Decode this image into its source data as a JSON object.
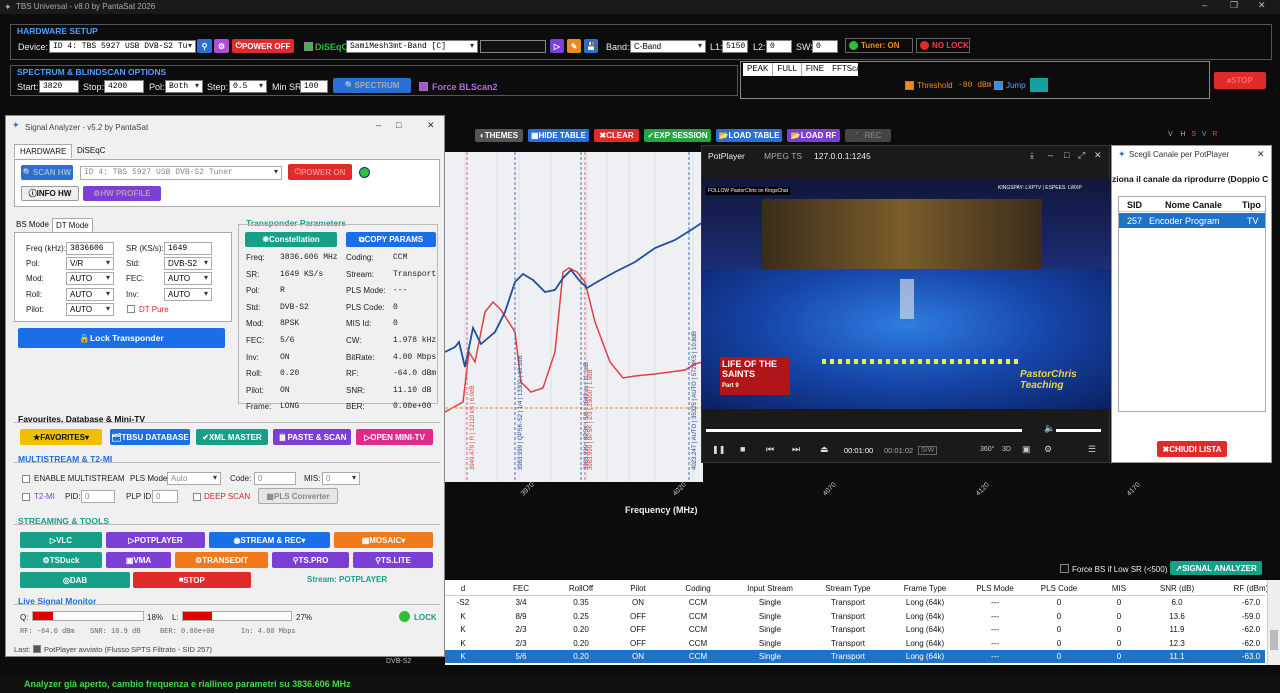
{
  "app": {
    "title": "TBS Universal - v8.0 by PantaSat 2026"
  },
  "hw": {
    "section": "HARDWARE SETUP",
    "device_label": "Device:",
    "device": "ID 4: TBS 5927 USB DVB-S2 Tu",
    "power": "POWER OFF",
    "diseqc": "DiSEqC",
    "sat": "SamiMesh3mt-Band [C]",
    "band_label": "Band:",
    "band": "C-Band",
    "l1_label": "L1:",
    "l1": "5150",
    "l2_label": "L2:",
    "l2": "0",
    "sw_label": "SW:",
    "sw": "0",
    "tuner": "Tuner: ON",
    "lock": "NO LOCK"
  },
  "spec": {
    "section": "SPECTRUM & BLINDSCAN OPTIONS",
    "start_label": "Start:",
    "start": "3820",
    "stop_label": "Stop:",
    "stop": "4200",
    "pol_label": "Pol:",
    "pol": "Both",
    "step_label": "Step:",
    "step": "0.5",
    "minsr_label": "Min SR:",
    "minsr": "100",
    "scan": "SPECTRUM",
    "force": "Force BLScan2",
    "tabs": [
      "PEAK",
      "FULL",
      "FINE",
      "FFTScan"
    ],
    "threshold": "Threshold",
    "threshold_val": "-80 dBm",
    "jump": "Jump",
    "stop_btn": "STOP"
  },
  "toolbar": {
    "themes": "THEMES",
    "hide": "HIDE TABLE",
    "clear": "CLEAR",
    "exp": "EXP SESSION",
    "load_table": "LOAD TABLE",
    "load_rf": "LOAD RF",
    "rec": "REC"
  },
  "chart_data": {
    "type": "line",
    "xlabel": "Frequency (MHz)",
    "x_ticks": [
      "3970",
      "4020",
      "4070",
      "4120",
      "4170"
    ],
    "series": [
      {
        "name": "blue",
        "color": "#1e4fa0"
      },
      {
        "name": "red",
        "color": "#e04040"
      }
    ],
    "legend_vals": [
      "V",
      "H",
      "S",
      "V",
      "R"
    ],
    "markers": [
      "3949.479 | R | 12110 kS | 6.0dB",
      "3983.999 | QPSK-S2 | 1/4 | 13300 | 10.1dB",
      "3983.999 | 8PSK | 5/6 | 1649 ks | 11.1dB",
      "3983.999 | 8PSK | 2/3 | 23000 | 1.9dB",
      "4023.247 | AUTO | 35325 | AUTO | 5728KS | 10.8dB"
    ]
  },
  "analyzer": {
    "title": "Signal Analyzer - v5.2 by PantaSat",
    "tabs": [
      "HARDWARE",
      "DiSEqC"
    ],
    "scan_hw": "SCAN HW",
    "device": "ID 4: TBS 5927 USB DVB-S2 Tuner",
    "power": "POWER ON",
    "info_hw": "INFO HW",
    "hw_profile": "HW PROFILE",
    "mode_tabs": [
      "BS Mode",
      "DT Mode"
    ],
    "freq_label": "Freq (kHz):",
    "freq": "3836606",
    "sr_label": "SR (KS/s):",
    "sr": "1649",
    "pol_label": "Pol:",
    "pol": "V/R",
    "std_label": "Std:",
    "std": "DVB-S2",
    "mod_label": "Mod:",
    "mod": "AUTO",
    "fec_label": "FEC:",
    "fec": "AUTO",
    "roll_label": "Roll:",
    "roll": "AUTO",
    "inv_label": "Inv:",
    "inv": "AUTO",
    "pilot_label": "Pilot:",
    "pilot": "AUTO",
    "dtpure": "DT Pure",
    "lock_btn": "Lock Transponder",
    "tp_title": "Transponder Parameters",
    "constellation": "Constellation",
    "copy": "COPY PARAMS",
    "params_left": [
      [
        "Freq:",
        "3836.606 MHz"
      ],
      [
        "SR:",
        "1649 KS/s"
      ],
      [
        "Pol:",
        "R"
      ],
      [
        "Std:",
        "DVB-S2"
      ],
      [
        "Mod:",
        "8PSK"
      ],
      [
        "FEC:",
        "5/6"
      ],
      [
        "Inv:",
        "ON"
      ],
      [
        "Roll:",
        "0.20"
      ],
      [
        "Pilot:",
        "ON"
      ],
      [
        "Frame:",
        "LONG"
      ]
    ],
    "params_right": [
      [
        "Coding:",
        "CCM"
      ],
      [
        "Stream:",
        "Transport"
      ],
      [
        "PLS Mode:",
        "---"
      ],
      [
        "PLS Code:",
        "0"
      ],
      [
        "MIS Id:",
        "0"
      ],
      [
        "CW:",
        "1.978 kHz"
      ],
      [
        "BitRate:",
        "4.00 Mbps"
      ],
      [
        "RF:",
        "-64.0 dBm"
      ],
      [
        "SNR:",
        "11.10 dB"
      ],
      [
        "BER:",
        "0.00e+00"
      ]
    ],
    "fav_title": "Favourites, Database & Mini-TV",
    "fav": "FAVORITES",
    "tbsu": "TBSU DATABASE",
    "xml": "XML MASTER",
    "paste": "PASTE & SCAN",
    "minitv": "OPEN MINI-TV",
    "ms_title": "MULTISTREAM & T2-MI",
    "enable_ms": "ENABLE MULTISTREAM",
    "pls_mode_label": "PLS Mode:",
    "pls_mode": "Auto",
    "code_label": "Code:",
    "code": "0",
    "mis_label": "MIS:",
    "mis": "0",
    "t2mi": "T2-MI",
    "pid_label": "PID:",
    "pid": "0",
    "plp_label": "PLP ID:",
    "plp": "0",
    "deepscan": "DEEP SCAN",
    "pls_conv": "PLS Converter",
    "st_title": "STREAMING & TOOLS",
    "vlc": "VLC",
    "potplayer": "POTPLAYER",
    "stream_rec": "STREAM & REC",
    "mosaic": "MOSAIC",
    "tsduck": "TSDuck",
    "vma": "VMA",
    "transedit": "TRANSEDIT",
    "tspro": "TS.PRO",
    "tslite": "TS.LITE",
    "dab": "DAB",
    "stop": "STOP",
    "stream_status": "Stream: POTPLAYER",
    "mon_title": "Live Signal Monitor",
    "q_label": "Q:",
    "q_pct": "18%",
    "q_level": 0.18,
    "l_label": "L:",
    "l_pct": "27%",
    "l_level": 0.27,
    "lock": "LOCK",
    "rf": "RF: -64.0 dBm",
    "snr": "SNR: 10.9 dB",
    "ber": "BER: 0.00e+00",
    "in": "In: 4.00 Mbps",
    "last": "Last:",
    "last_msg": "PotPlayer avviato (Flusso SPTS Filtrato - SID 257)"
  },
  "player": {
    "title": "PotPlayer",
    "fmt": "MPEG TS",
    "addr": "127.0.0.1:1245",
    "time_cur": "00:01:00",
    "time_total": "00:01:02",
    "sw": "S/W",
    "b360": "360°",
    "b3d": "3D",
    "ticker": "KINGSPAY: LXPTV | ESPEES: LWXP",
    "follow": "FOLLOW PastorChris on KingsChat",
    "show1": "LIFE OF THE SAINTS",
    "part": "Part 9",
    "brand": "PastorChris Teaching"
  },
  "chooser": {
    "title": "Scegli Canale per PotPlayer",
    "prompt": "ziona il canale da riprodurre (Doppio C",
    "headers": [
      "SID",
      "Nome Canale",
      "Tipo"
    ],
    "row": [
      "257",
      "Encoder Program",
      "TV"
    ],
    "close": "CHIUDI LISTA"
  },
  "table": {
    "force_bs": "Force BS if Low SR (<500)",
    "sig_an": "SIGNAL ANALYZER",
    "headers": [
      "d",
      "FEC",
      "RollOff",
      "Pilot",
      "Coding",
      "Input Stream",
      "Stream Type",
      "Frame Type",
      "PLS Mode",
      "PLS Code",
      "MIS",
      "SNR (dB)",
      "RF (dBm)"
    ],
    "rows": [
      [
        "-S2",
        "3/4",
        "0.35",
        "ON",
        "CCM",
        "Single",
        "Transport",
        "Long (64k)",
        "---",
        "0",
        "0",
        "6.0",
        "-67.0"
      ],
      [
        "K",
        "8/9",
        "0.25",
        "OFF",
        "CCM",
        "Single",
        "Transport",
        "Long (64k)",
        "---",
        "0",
        "0",
        "13.6",
        "-59.0"
      ],
      [
        "K",
        "2/3",
        "0.20",
        "OFF",
        "CCM",
        "Single",
        "Transport",
        "Long (64k)",
        "---",
        "0",
        "0",
        "11.9",
        "-62.0"
      ],
      [
        "K",
        "2/3",
        "0.20",
        "OFF",
        "CCM",
        "Single",
        "Transport",
        "Long (64k)",
        "---",
        "0",
        "0",
        "12.3",
        "-62.0"
      ],
      [
        "K",
        "5/6",
        "0.20",
        "ON",
        "CCM",
        "Single",
        "Transport",
        "Long (64k)",
        "---",
        "0",
        "0",
        "11.1",
        "-63.0"
      ]
    ],
    "partial": "DVB-S2"
  },
  "status": {
    "text": "Analyzer già aperto, cambio frequenza e riallineo parametri su 3836.606 MHz"
  }
}
